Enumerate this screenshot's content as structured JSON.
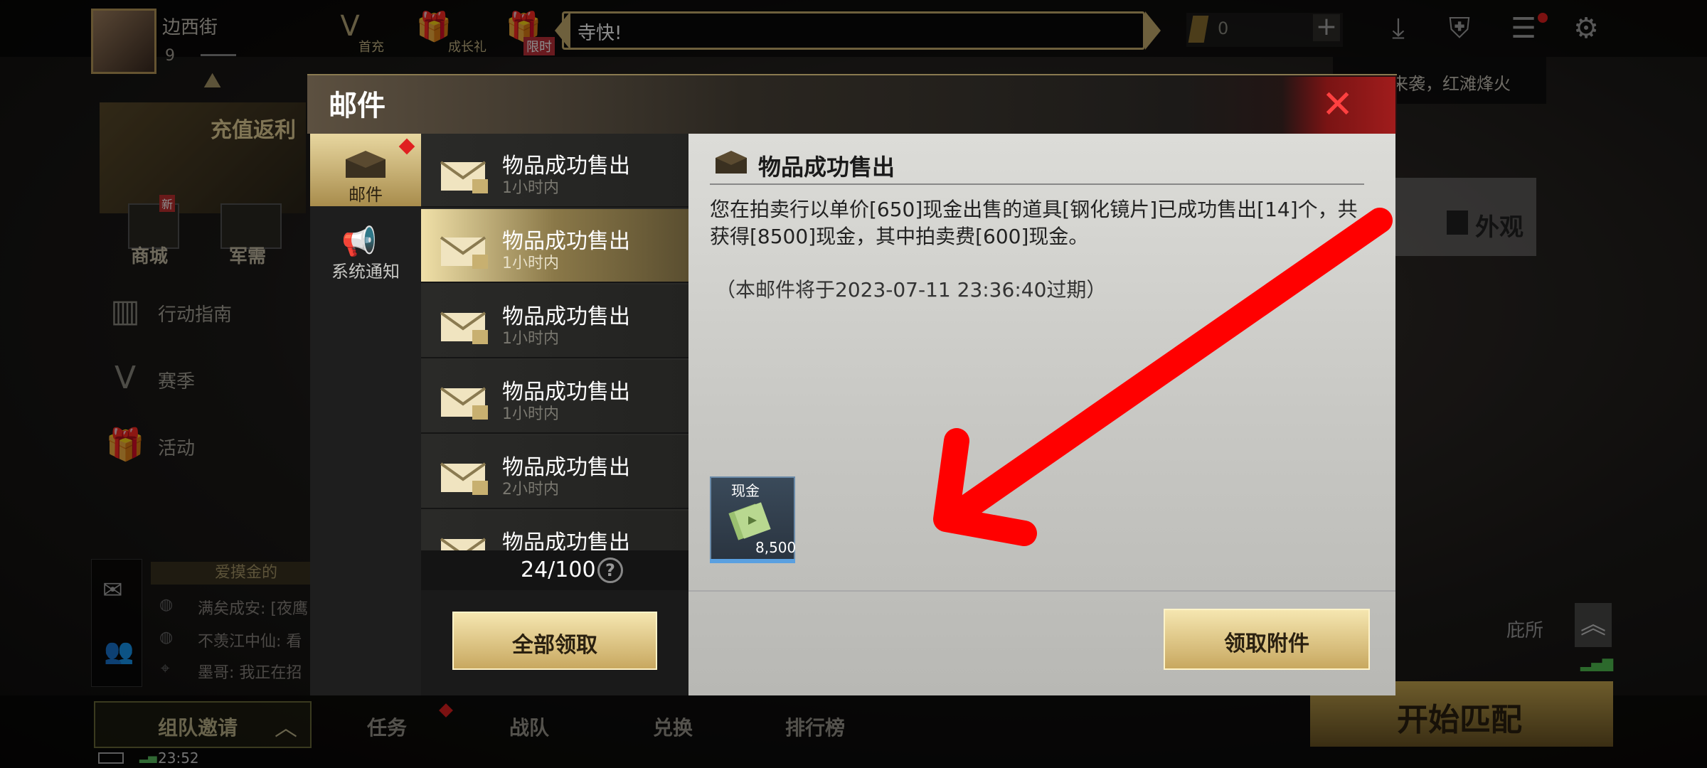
{
  "player": {
    "name": "边西街",
    "level": "9"
  },
  "top_nav": {
    "first_recharge": "首充",
    "growth_gift": "成长礼",
    "limited": "限时",
    "ticker": "寺快!",
    "currency_value": "0",
    "notify_text": "福利礼来袭，红滩烽火"
  },
  "left_panel": {
    "rebate": "充值返利",
    "shop": "商城",
    "military": "军需",
    "shop_badge": "新",
    "guide": "行动指南",
    "season": "赛季",
    "activity": "活动"
  },
  "chat": {
    "header": "爱摸金的",
    "lines": [
      "满矣成安: [夜鹰",
      "不羡江中仙: 看",
      "墨哥: 我正在招"
    ]
  },
  "bottom": {
    "team_invite": "组队邀请",
    "tabs": [
      "任务",
      "战队",
      "兑换",
      "排行榜"
    ],
    "start_match": "开始匹配",
    "time": "23:52",
    "appearance": "外观",
    "shelter": "庇所"
  },
  "mail": {
    "title": "邮件",
    "categories": [
      {
        "label": "邮件"
      },
      {
        "label": "系统通知"
      }
    ],
    "items": [
      {
        "title": "物品成功售出",
        "time": "1小时内"
      },
      {
        "title": "物品成功售出",
        "time": "1小时内"
      },
      {
        "title": "物品成功售出",
        "time": "1小时内"
      },
      {
        "title": "物品成功售出",
        "time": "1小时内"
      },
      {
        "title": "物品成功售出",
        "time": "2小时内"
      },
      {
        "title": "物品成功售出",
        "time": ""
      }
    ],
    "count": "24/100",
    "help": "?",
    "claim_all": "全部领取",
    "detail": {
      "title": "物品成功售出",
      "body": "您在拍卖行以单价[650]现金出售的道具[钢化镜片]已成功售出[14]个，共获得[8500]现金，其中拍卖费[600]现金。",
      "expire": "（本邮件将于2023-07-11 23:36:40过期）",
      "attachment_name": "现金",
      "attachment_qty": "8,500",
      "claim_attachment": "领取附件"
    }
  },
  "colors": {
    "accent_gold": "#c8a860",
    "close_red": "#ff4040",
    "arrow_red": "#ff0000"
  }
}
